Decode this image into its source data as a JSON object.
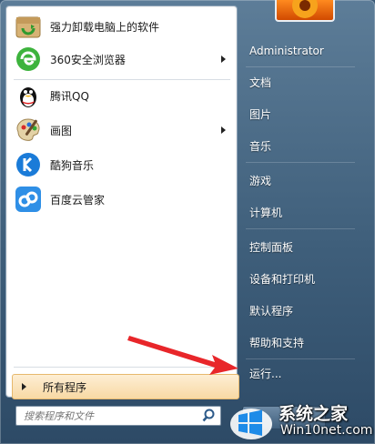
{
  "programs": [
    {
      "label": "强力卸载电脑上的软件",
      "icon": "uninstaller-box-icon",
      "has_submenu": false
    },
    {
      "label": "360安全浏览器",
      "icon": "360-browser-icon",
      "has_submenu": true
    },
    {
      "label": "腾讯QQ",
      "icon": "qq-penguin-icon",
      "has_submenu": false
    },
    {
      "label": "画图",
      "icon": "paint-palette-icon",
      "has_submenu": true
    },
    {
      "label": "酷狗音乐",
      "icon": "kugou-music-icon",
      "has_submenu": false
    },
    {
      "label": "百度云管家",
      "icon": "baidu-cloud-icon",
      "has_submenu": false
    }
  ],
  "all_programs": {
    "label": "所有程序"
  },
  "search": {
    "placeholder": "搜索程序和文件"
  },
  "right": {
    "items": [
      {
        "label": "Administrator"
      },
      {
        "label": "文档"
      },
      {
        "label": "图片"
      },
      {
        "label": "音乐"
      },
      {
        "label": "游戏"
      },
      {
        "label": "计算机"
      },
      {
        "label": "控制面板"
      },
      {
        "label": "设备和打印机"
      },
      {
        "label": "默认程序"
      },
      {
        "label": "帮助和支持"
      },
      {
        "label": "运行..."
      }
    ]
  },
  "watermark": {
    "title": "系统之家",
    "site": "Win10net.com"
  },
  "colors": {
    "highlight": "#f8d9a4",
    "annotation_arrow": "#e8262a",
    "menu_blue": "#3f5f7b"
  }
}
